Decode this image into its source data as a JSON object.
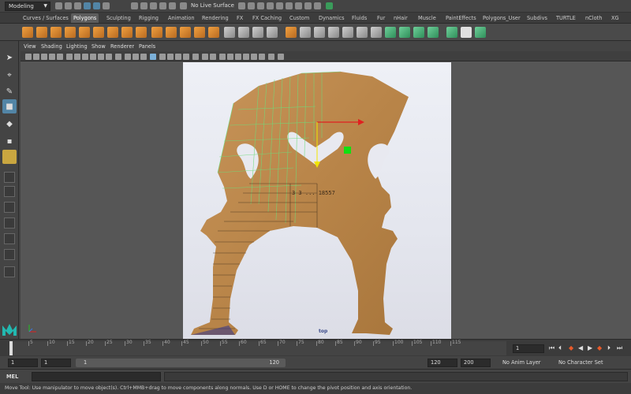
{
  "status_line": {
    "menu_set": "Modeling",
    "live_surface": "No Live Surface"
  },
  "shelf": {
    "tabs": [
      "Curves / Surfaces",
      "Polygons",
      "Sculpting",
      "Rigging",
      "Animation",
      "Rendering",
      "FX",
      "FX Caching",
      "Custom",
      "Dynamics",
      "Fluids",
      "Fur",
      "nHair",
      "Muscle",
      "PaintEffects",
      "Polygons_User",
      "Subdivs",
      "TURTLE",
      "nCloth",
      "XG"
    ],
    "active_tab": "Polygons"
  },
  "panel": {
    "menus": [
      "View",
      "Shading",
      "Lighting",
      "Show",
      "Renderer",
      "Panels"
    ],
    "view_label": "top"
  },
  "image_plane": {
    "stamp_text": "3 3 ... 18557"
  },
  "time_slider": {
    "tick_labels": [
      "5",
      "10",
      "15",
      "20",
      "25",
      "30",
      "35",
      "40",
      "45",
      "50",
      "55",
      "60",
      "65",
      "70",
      "75",
      "80",
      "85",
      "90",
      "95",
      "100",
      "105",
      "110",
      "115"
    ],
    "current_frame": "1"
  },
  "range_slider": {
    "start_field": "1",
    "start_field_2": "1",
    "range_start": "1",
    "range_end": "120",
    "end_field": "120",
    "end_field_2": "200",
    "anim_layer": "No Anim Layer",
    "character_set": "No Character Set"
  },
  "command_line": {
    "label": "MEL"
  },
  "help_line": {
    "text": "Move Tool: Use manipulator to move object(s). Ctrl+MMB+drag to move components along normals. Use D or HOME to change the pivot position and axis orientation."
  },
  "colors": {
    "selection_blue": "#5285a6",
    "wire_green": "#6fdc7a",
    "gizmo_red": "#e02020",
    "gizmo_green": "#11e011",
    "gizmo_yellow": "#f2e600"
  }
}
